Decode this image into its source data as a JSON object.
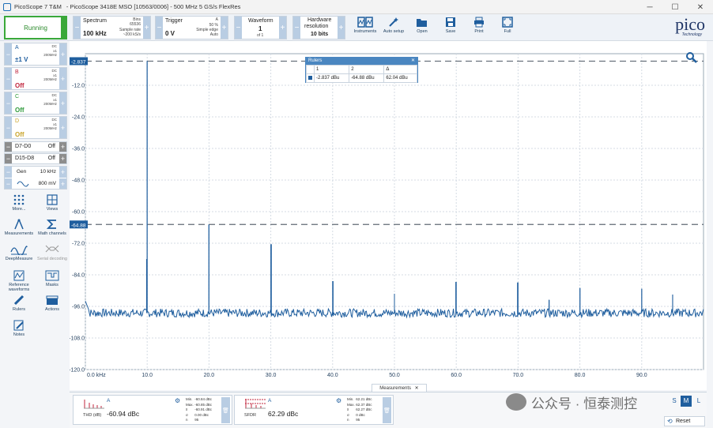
{
  "window": {
    "app_name": "PicoScope 7 T&M",
    "device": "- PicoScope 3418E MSO [10563/0006] - 500 MHz 5 GS/s FlexRes",
    "min": "─",
    "max": "☐",
    "close": "✕"
  },
  "toolbar": {
    "run_label": "Running",
    "spectrum": {
      "title": "Spectrum",
      "value": "100 kHz",
      "bins_label": "Bins",
      "bins_value": "65536",
      "sample_rate_label": "Sample rate",
      "sample_rate_value": "~200 kS/s"
    },
    "trigger": {
      "title": "Trigger",
      "channel": "A",
      "value": "0 V",
      "percent": "50 %",
      "type": "Simple edge",
      "mode": "Auto"
    },
    "waveform": {
      "title": "Waveform",
      "value": "1",
      "of": "of 1"
    },
    "hwres": {
      "title": "Hardware",
      "title2": "resolution",
      "value": "10 bits"
    },
    "buttons": {
      "instruments": "Instruments",
      "autosetup": "Auto setup",
      "open": "Open",
      "save": "Save",
      "print": "Print",
      "full": "Full"
    },
    "logo": {
      "word": "pico",
      "sub": "Technology"
    }
  },
  "channels": [
    {
      "name": "A",
      "value": "±1 V",
      "coupling": "DC",
      "probe": "x1",
      "bw": "200MHz",
      "color": "#1f5e9e"
    },
    {
      "name": "B",
      "value": "Off",
      "coupling": "DC",
      "probe": "x1",
      "bw": "200MHz",
      "color": "#c0243c"
    },
    {
      "name": "C",
      "value": "Off",
      "coupling": "DC",
      "probe": "x1",
      "bw": "200MHz",
      "color": "#2e9a3a"
    },
    {
      "name": "D",
      "value": "Off",
      "coupling": "DC",
      "probe": "x1",
      "bw": "200MHz",
      "color": "#c9a42a"
    }
  ],
  "digital": [
    {
      "name": "D7-D0",
      "state": "Off"
    },
    {
      "name": "D15-D8",
      "state": "Off"
    }
  ],
  "generator": {
    "label": "Gen",
    "freq": "10 kHz",
    "amplitude": "800 mV"
  },
  "tools": {
    "more": "More...",
    "views": "Views",
    "measurements": "Measurements",
    "math": "Math channels",
    "deepmeasure": "DeepMeasure",
    "serial": "Serial decoding",
    "refwave": "Reference waveforms",
    "masks": "Masks",
    "rulers": "Rulers",
    "actions": "Actions",
    "notes": "Notes"
  },
  "ruler_labels": {
    "r1": "-2.837",
    "r2": "-64.88"
  },
  "ruler_window": {
    "title": "Rulers",
    "close": "✕",
    "col1": "1",
    "col2": "2",
    "col3": "Δ",
    "v1": "-2.837 dBu",
    "v2": "-64.88 dBu",
    "delta": "62.04 dBu"
  },
  "measurements": {
    "tab_label": "Measurements",
    "tab_close": "✕",
    "cards": [
      {
        "name": "THD (dB)",
        "channel": "A",
        "value": "-60.94 dBc",
        "min": "-60.84 dBc",
        "max": "-60.85 dBc",
        "sigma": "-60.91 dBc",
        "delta": "0.00 dBc",
        "n": "95"
      },
      {
        "name": "SFDR",
        "channel": "A",
        "value": "62.29 dBc",
        "min": "62.21 dBc",
        "max": "62.37 dBc",
        "sigma": "62.27 dBc",
        "delta": "0 dBc",
        "n": "95"
      }
    ],
    "stat_labels": {
      "min": "Min.",
      "max": "Max.",
      "sigma": "x̄",
      "sd": "σ",
      "n": "n"
    }
  },
  "size_buttons": {
    "s": "S",
    "m": "M",
    "l": "L"
  },
  "reset_label": "Reset",
  "watermark": "公众号 · 恒泰测控",
  "chart_data": {
    "type": "line",
    "xlabel": "kHz",
    "ylabel": "",
    "xlim": [
      0,
      100
    ],
    "ylim": [
      -120,
      0
    ],
    "x_ticks": [
      0,
      10,
      20,
      30,
      40,
      50,
      60,
      70,
      80,
      90
    ],
    "x_tick_labels": [
      "0.0 kHz",
      "10.0",
      "20.0",
      "30.0",
      "40.0",
      "50.0",
      "60.0",
      "70.0",
      "80.0",
      "90.0"
    ],
    "y_ticks": [
      -12,
      -24,
      -36,
      -48,
      -60,
      -72,
      -84,
      -96,
      -108,
      -120
    ],
    "y_tick_labels": [
      "-12.0",
      "-24.0",
      "-36.0",
      "-48.0",
      "-60.0",
      "-72.0",
      "-84.0",
      "-96.0",
      "-108.0",
      "-120.0"
    ],
    "rulers": [
      -2.837,
      -64.88
    ],
    "noise_floor": -98.5,
    "grid": true,
    "color": "#1f5e9e",
    "series": [
      {
        "x": [
          10,
          20,
          30,
          40,
          50,
          60,
          70,
          75,
          80,
          90,
          95
        ],
        "values": [
          -2.8,
          -64.9,
          -72.4,
          -86.4,
          -91.2,
          -86.7,
          -86.9,
          -93.5,
          -89.0,
          -89.3,
          -91.5
        ]
      }
    ]
  }
}
